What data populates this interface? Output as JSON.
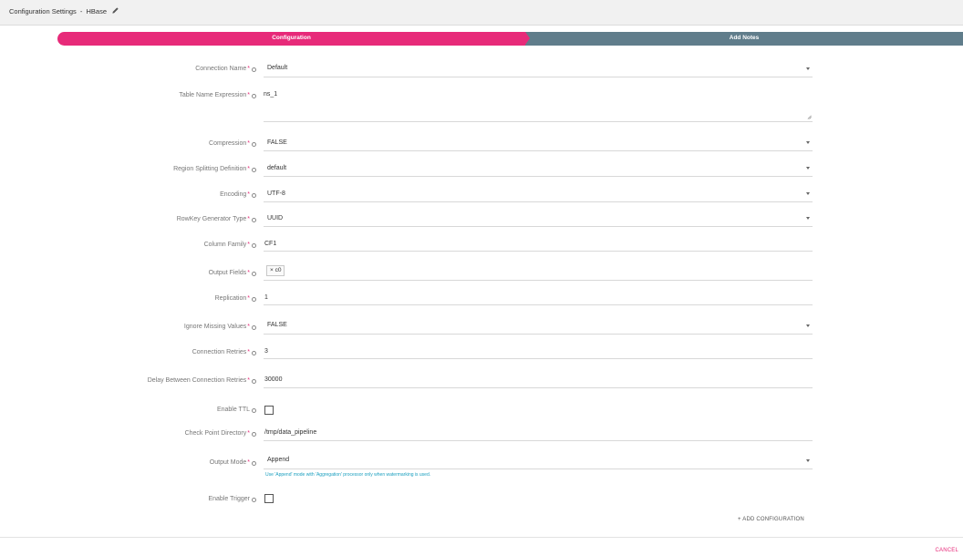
{
  "header": {
    "title": "Configuration Settings",
    "separator": "-",
    "component": "HBase",
    "edit_icon": "pencil-icon"
  },
  "tabs": [
    {
      "label": "Configuration",
      "active": true,
      "color": "#e72a79"
    },
    {
      "label": "Add Notes",
      "active": false,
      "color": "#607d8b"
    }
  ],
  "required_marker": "*",
  "info_icon": "info-circle-icon",
  "form": {
    "connection_name": {
      "label": "Connection Name",
      "value": "Default"
    },
    "table_name_expression": {
      "label": "Table Name Expression",
      "value": "ns_1"
    },
    "compression": {
      "label": "Compression",
      "value": "FALSE"
    },
    "region_splitting_definition": {
      "label": "Region Splitting Definition",
      "value": "default"
    },
    "encoding": {
      "label": "Encoding",
      "value": "UTF-8"
    },
    "rowkey_generator_type": {
      "label": "RowKey Generator Type",
      "value": "UUID"
    },
    "column_family": {
      "label": "Column Family",
      "value": "CF1"
    },
    "output_fields": {
      "label": "Output Fields",
      "chips": [
        "× c0"
      ]
    },
    "replication": {
      "label": "Replication",
      "value": "1"
    },
    "ignore_missing_values": {
      "label": "Ignore Missing Values",
      "value": "FALSE"
    },
    "connection_retries": {
      "label": "Connection Retries",
      "value": "3"
    },
    "delay_between_connection_retries": {
      "label": "Delay Between Connection Retries",
      "value": "30000"
    },
    "enable_ttl": {
      "label": "Enable TTL",
      "checked": false
    },
    "check_point_directory": {
      "label": "Check Point Directory",
      "value": "/tmp/data_pipeline"
    },
    "output_mode": {
      "label": "Output Mode",
      "value": "Append",
      "hint": "Use 'Append' mode with 'Aggregation' processor only when watermarking is used."
    },
    "enable_trigger": {
      "label": "Enable Trigger",
      "checked": false
    }
  },
  "actions": {
    "add_configuration": "+ ADD CONFIGURATION",
    "cancel": "CANCEL"
  },
  "colors": {
    "accent": "#e72a79",
    "secondary_tab": "#607d8b",
    "hint": "#1a9fbf"
  }
}
